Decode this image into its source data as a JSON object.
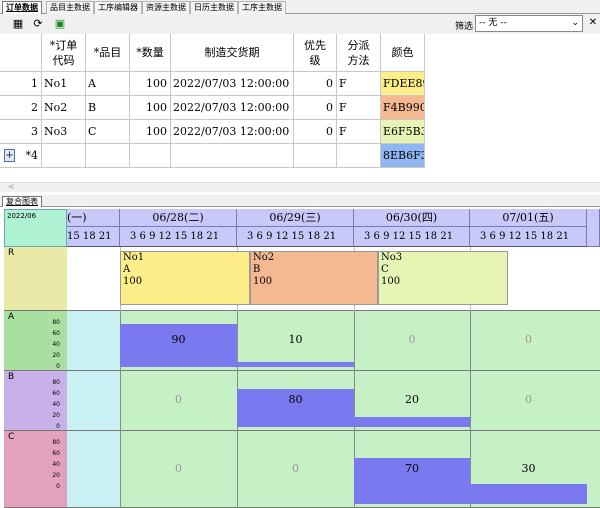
{
  "tabs": [
    {
      "label": "订单数据",
      "active": true
    },
    {
      "label": "品目主数据",
      "active": false
    },
    {
      "label": "工序编辑器",
      "active": false
    },
    {
      "label": "资源主数据",
      "active": false
    },
    {
      "label": "日历主数据",
      "active": false
    },
    {
      "label": "工序主数据",
      "active": false
    }
  ],
  "toolbar": {
    "filter_label": "筛选",
    "filter_value": "-- 无 --",
    "icons": [
      "table-icon",
      "refresh-icon",
      "calc-icon"
    ]
  },
  "order_table": {
    "columns": [
      {
        "label": "*订单\n代码"
      },
      {
        "label": "*品目"
      },
      {
        "label": "*数量"
      },
      {
        "label": "制造交货期"
      },
      {
        "label": "优先\n级"
      },
      {
        "label": "分派\n方法"
      },
      {
        "label": "颜色"
      }
    ],
    "rows": [
      {
        "index": "1",
        "code": "No1",
        "item": "A",
        "qty": "100",
        "due": "2022/07/03  12:00:00",
        "priority": "0",
        "method": "F",
        "color": "FDEE89",
        "color_hex": "#FDEE89"
      },
      {
        "index": "2",
        "code": "No2",
        "item": "B",
        "qty": "100",
        "due": "2022/07/03  12:00:00",
        "priority": "0",
        "method": "F",
        "color": "F4B990",
        "color_hex": "#F4B990"
      },
      {
        "index": "3",
        "code": "No3",
        "item": "C",
        "qty": "100",
        "due": "2022/07/03  12:00:00",
        "priority": "0",
        "method": "F",
        "color": "E6F5B3",
        "color_hex": "#E6F5B3"
      },
      {
        "index": "*4",
        "code": "",
        "item": "",
        "qty": "",
        "due": "",
        "priority": "",
        "method": "",
        "color": "8EB6F3",
        "color_hex": "#8EB6F3"
      }
    ],
    "add_symbol": "+"
  },
  "scroll_left": "<",
  "gantt": {
    "tab_label": "复合图表",
    "date_label": "2022/06",
    "days": [
      {
        "label": "(一)",
        "hours": "15 18 21"
      },
      {
        "label": "06/28(二)",
        "hours": "3  6  9 12 15 18 21"
      },
      {
        "label": "06/29(三)",
        "hours": "3  6  9 12 15 18 21"
      },
      {
        "label": "06/30(四)",
        "hours": "3  6  9 12 15 18 21"
      },
      {
        "label": "07/01(五)",
        "hours": "3  6  9 12 15 18 21"
      }
    ],
    "resources": [
      {
        "name": "R"
      },
      {
        "name": "A",
        "ticks": [
          "80",
          "60",
          "40",
          "20",
          "0"
        ]
      },
      {
        "name": "B",
        "ticks": [
          "80",
          "60",
          "40",
          "20",
          "0"
        ]
      },
      {
        "name": "C",
        "ticks": [
          "80",
          "60",
          "40",
          "20",
          "0"
        ]
      }
    ],
    "tasks": [
      {
        "code": "No1",
        "item": "A",
        "qty": "100",
        "color": "#FDEE89"
      },
      {
        "code": "No2",
        "item": "B",
        "qty": "100",
        "color": "#F4B990"
      },
      {
        "code": "No3",
        "item": "C",
        "qty": "100",
        "color": "#E6F5B3"
      }
    ],
    "loads": {
      "A": [
        "90",
        "10",
        "0",
        "0"
      ],
      "B": [
        "0",
        "80",
        "20",
        "0"
      ],
      "C": [
        "0",
        "0",
        "70",
        "30"
      ]
    },
    "load_values": {
      "A": [
        90,
        10,
        0,
        0
      ],
      "B": [
        0,
        80,
        20,
        0
      ],
      "C": [
        0,
        0,
        70,
        30
      ]
    },
    "y_max": 100
  }
}
